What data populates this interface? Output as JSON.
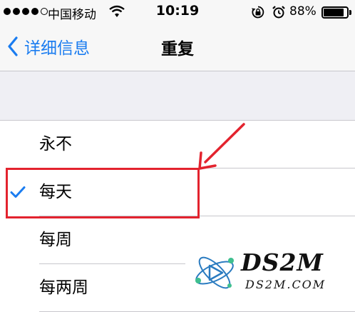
{
  "status_bar": {
    "carrier": "中国移动",
    "time": "10:19",
    "battery_percent": "88%",
    "battery_level": 0.88,
    "signal_bars_filled": 4,
    "signal_bars_total": 5,
    "icons": [
      "wifi-icon",
      "rotation-lock-icon",
      "alarm-icon",
      "battery-icon"
    ]
  },
  "nav": {
    "back_label": "详细信息",
    "title": "重复",
    "accent_color": "#1a7cf0"
  },
  "repeat_options": [
    {
      "label": "永不",
      "selected": false
    },
    {
      "label": "每天",
      "selected": true
    },
    {
      "label": "每周",
      "selected": false
    },
    {
      "label": "每两周",
      "selected": false
    }
  ],
  "annotation": {
    "color": "#e3232e",
    "target": "每天"
  },
  "watermark": {
    "title": "DS2M",
    "subtitle": "DS2M.COM"
  }
}
